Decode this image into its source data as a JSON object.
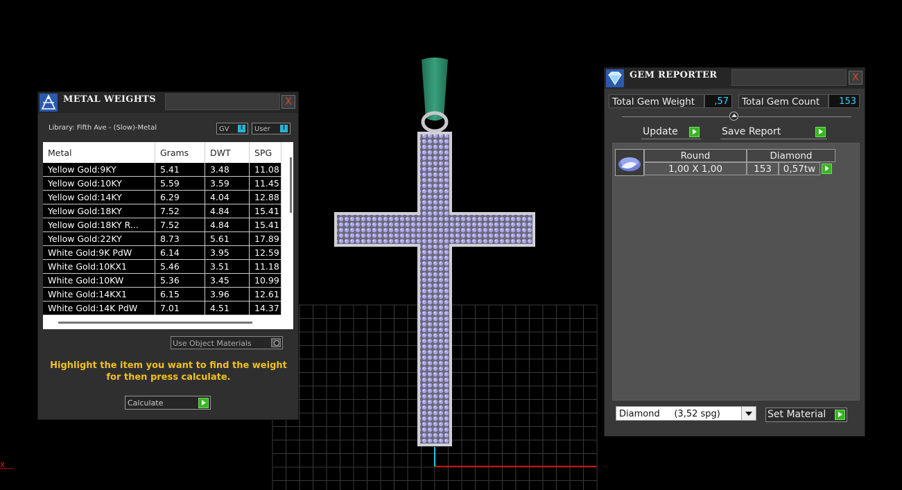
{
  "metal_weights": {
    "title": "METAL WEIGHTS",
    "close_label": "X",
    "library_label": "Library: Fifth Ave - (Slow)-Metal",
    "chips": [
      {
        "label": "GV",
        "mark": "I"
      },
      {
        "label": "User",
        "mark": "I"
      }
    ],
    "columns": [
      "Metal",
      "Grams",
      "DWT",
      "SPG"
    ],
    "rows": [
      [
        "Yellow Gold:9KY",
        "5.41",
        "3.48",
        "11.08"
      ],
      [
        "Yellow Gold:10KY",
        "5.59",
        "3.59",
        "11.45"
      ],
      [
        "Yellow Gold:14KY",
        "6.29",
        "4.04",
        "12.88"
      ],
      [
        "Yellow Gold:18KY",
        "7.52",
        "4.84",
        "15.41"
      ],
      [
        "Yellow Gold:18KY R...",
        "7.52",
        "4.84",
        "15.41"
      ],
      [
        "Yellow Gold:22KY",
        "8.73",
        "5.61",
        "17.89"
      ],
      [
        "White Gold:9K PdW",
        "6.14",
        "3.95",
        "12.59"
      ],
      [
        "White Gold:10KX1",
        "5.46",
        "3.51",
        "11.18"
      ],
      [
        "White Gold:10KW",
        "5.36",
        "3.45",
        "10.99"
      ],
      [
        "White Gold:14KX1",
        "6.15",
        "3.96",
        "12.61"
      ],
      [
        "White Gold:14K PdW",
        "7.01",
        "4.51",
        "14.37"
      ]
    ],
    "use_object_materials": "Use Object Materials",
    "hint": "Highlight the item you want to find the weight for then press calculate.",
    "calculate_label": "Calculate",
    "icon": "metal-weights-icon"
  },
  "gem_reporter": {
    "title": "GEM REPORTER",
    "close_label": "X",
    "total_gem_weight_label": "Total Gem Weight",
    "total_gem_weight": ",57",
    "total_gem_count_label": "Total Gem Count",
    "total_gem_count": "153",
    "update_label": "Update",
    "save_report_label": "Save Report",
    "gem_row": {
      "shape": "Round",
      "material": "Diamond",
      "size": "1,00 X 1,00",
      "count": "153",
      "weight": "0,57tw"
    },
    "material_select": "Diamond     (3,52 spg)",
    "set_material_label": "Set Material",
    "icon": "gem-reporter-icon"
  },
  "viewport": {
    "axis_label": "x",
    "colors": {
      "bail": "#2f8a6a",
      "metal": "#b9b9c0",
      "gem": "#a9a6e8",
      "grid": "#3a3a3a",
      "axis_red": "#cc1111",
      "axis_cyan": "#1ec8e0"
    }
  }
}
